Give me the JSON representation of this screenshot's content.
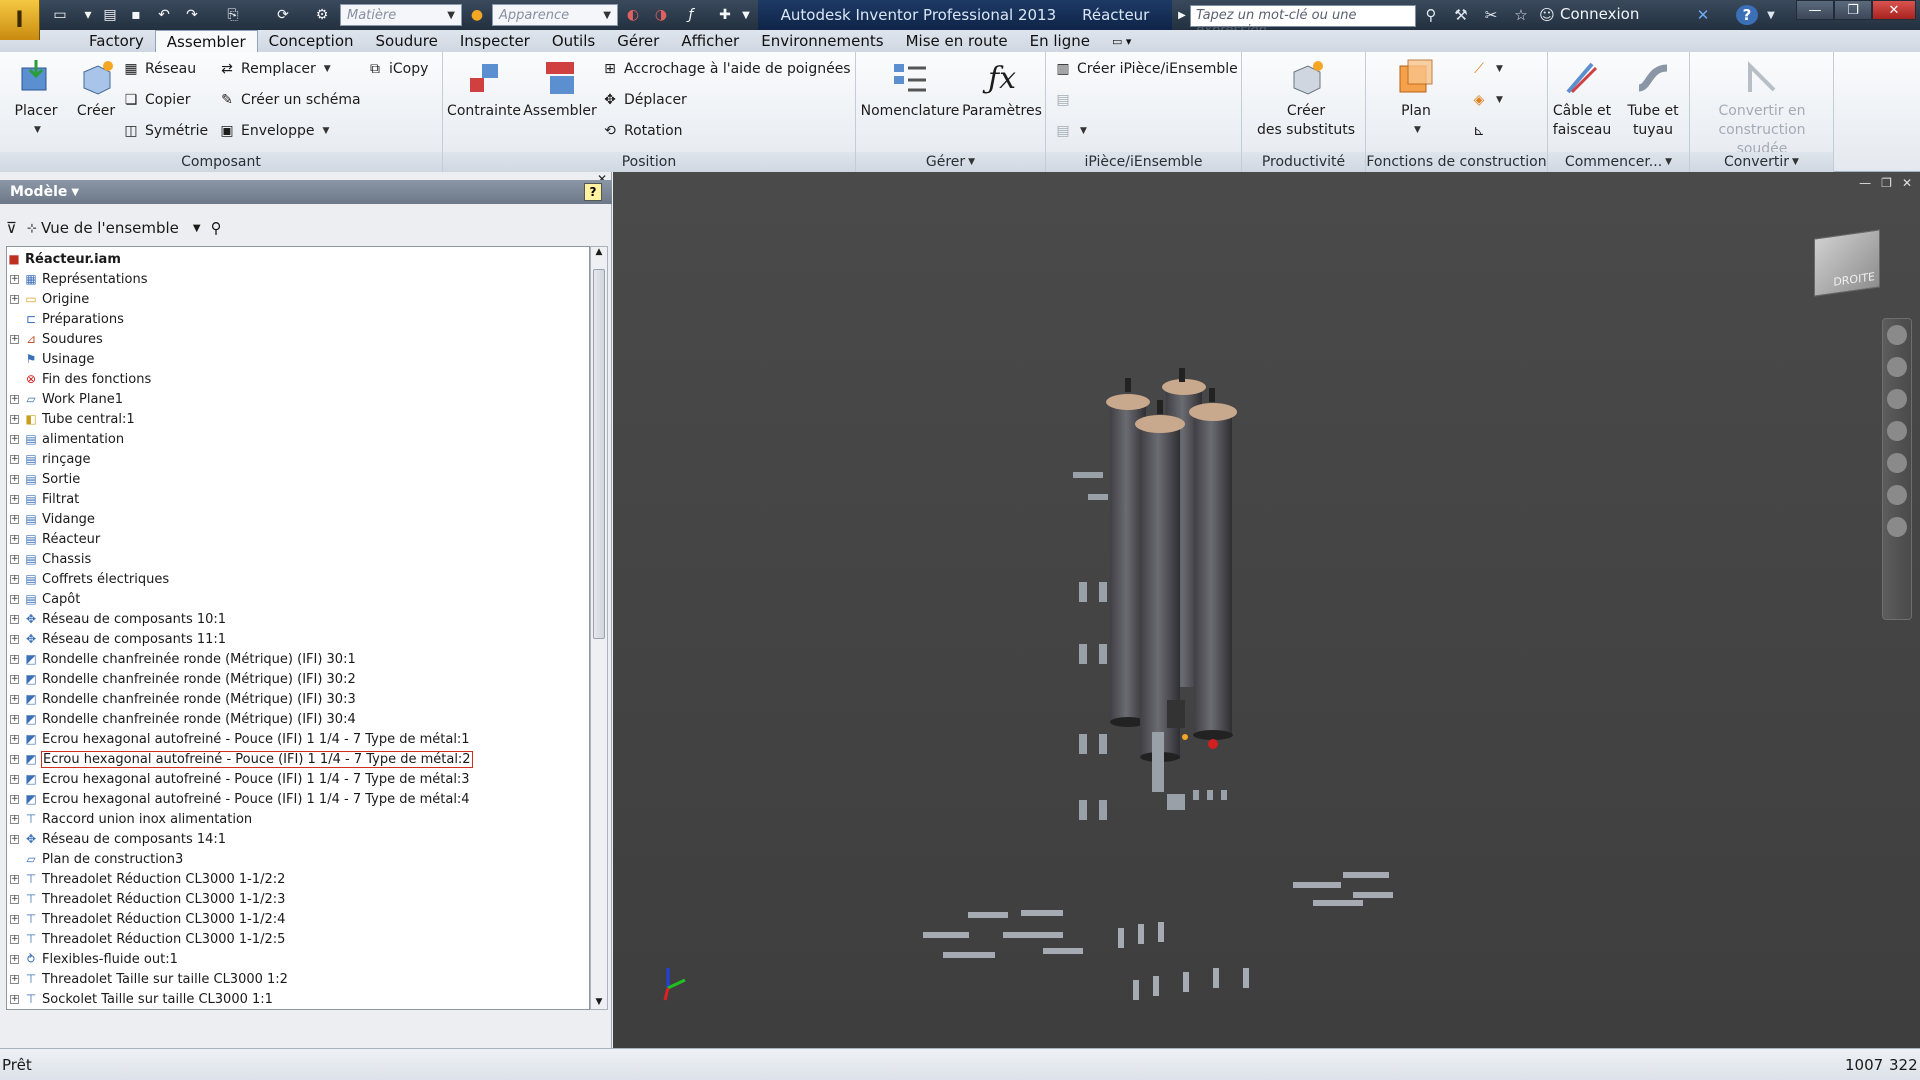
{
  "titlebar": {
    "app_title": "Autodesk Inventor Professional 2013",
    "doc_title": "Réacteur",
    "material_placeholder": "Matière",
    "appearance_placeholder": "Apparence",
    "search_placeholder": "Tapez un mot-clé ou une expression",
    "connexion": "Connexion",
    "help": "?"
  },
  "menu": {
    "tabs": [
      "Factory",
      "Assembler",
      "Conception",
      "Soudure",
      "Inspecter",
      "Outils",
      "Gérer",
      "Afficher",
      "Environnements",
      "Mise en route",
      "En ligne"
    ],
    "active": 1
  },
  "ribbon": {
    "composant": {
      "label": "Composant",
      "placer": "Placer",
      "creer": "Créer",
      "reseau": "Réseau",
      "copier": "Copier",
      "symetrie": "Symétrie",
      "remplacer": "Remplacer",
      "creer_schema": "Créer un schéma",
      "enveloppe": "Enveloppe",
      "icopy": "iCopy"
    },
    "position": {
      "label": "Position",
      "contrainte": "Contrainte",
      "assembler": "Assembler",
      "accrochage": "Accrochage à l'aide de poignées",
      "deplacer": "Déplacer",
      "rotation": "Rotation"
    },
    "gerer": {
      "label": "Gérer",
      "nomenclature": "Nomenclature",
      "parametres": "Paramètres"
    },
    "ipiece": {
      "label": "iPièce/iEnsemble",
      "creer": "Créer iPièce/iEnsemble"
    },
    "productivite": {
      "label": "Productivité",
      "creer_line1": "Créer",
      "creer_line2": "des substituts"
    },
    "fonctions": {
      "label": "Fonctions de construction",
      "plan": "Plan"
    },
    "commencer": {
      "label": "Commencer...",
      "cable_line1": "Câble et",
      "cable_line2": "faisceau",
      "tube_line1": "Tube et",
      "tube_line2": "tuyau"
    },
    "convertir": {
      "label": "Convertir",
      "conv_line1": "Convertir en",
      "conv_line2": "construction soudée"
    }
  },
  "browser": {
    "header": "Modèle",
    "view_label": "Vue de l'ensemble",
    "root": "Réacteur.iam",
    "nodes": [
      {
        "label": "Représentations",
        "exp": true,
        "icon": "representations-icon"
      },
      {
        "label": "Origine",
        "exp": true,
        "icon": "folder-icon"
      },
      {
        "label": "Préparations",
        "exp": false,
        "icon": "preparations-icon"
      },
      {
        "label": "Soudures",
        "exp": true,
        "icon": "welds-icon"
      },
      {
        "label": "Usinage",
        "exp": false,
        "icon": "machining-icon"
      },
      {
        "label": "Fin des fonctions",
        "exp": false,
        "icon": "end-of-features-icon"
      },
      {
        "label": "Work Plane1",
        "exp": true,
        "icon": "work-plane-icon"
      },
      {
        "label": "Tube central:1",
        "exp": true,
        "icon": "part-adaptive-icon"
      },
      {
        "label": "alimentation",
        "exp": true,
        "icon": "sub-assembly-icon"
      },
      {
        "label": "rinçage",
        "exp": true,
        "icon": "sub-assembly-icon"
      },
      {
        "label": "Sortie",
        "exp": true,
        "icon": "sub-assembly-icon"
      },
      {
        "label": "Filtrat",
        "exp": true,
        "icon": "sub-assembly-icon"
      },
      {
        "label": "Vidange",
        "exp": true,
        "icon": "sub-assembly-icon"
      },
      {
        "label": "Réacteur",
        "exp": true,
        "icon": "sub-assembly-icon"
      },
      {
        "label": "Chassis",
        "exp": true,
        "icon": "sub-assembly-icon"
      },
      {
        "label": "Coffrets électriques",
        "exp": true,
        "icon": "sub-assembly-icon"
      },
      {
        "label": "Capôt",
        "exp": true,
        "icon": "sub-assembly-icon"
      },
      {
        "label": "Réseau de composants 10:1",
        "exp": true,
        "icon": "pattern-icon"
      },
      {
        "label": "Réseau de composants 11:1",
        "exp": true,
        "icon": "pattern-icon"
      },
      {
        "label": "Rondelle chanfreinée ronde (Métrique) (IFI) 30:1",
        "exp": true,
        "icon": "part-icon"
      },
      {
        "label": "Rondelle chanfreinée ronde (Métrique) (IFI) 30:2",
        "exp": true,
        "icon": "part-icon"
      },
      {
        "label": "Rondelle chanfreinée ronde (Métrique) (IFI) 30:3",
        "exp": true,
        "icon": "part-icon"
      },
      {
        "label": "Rondelle chanfreinée ronde (Métrique) (IFI) 30:4",
        "exp": true,
        "icon": "part-icon"
      },
      {
        "label": "Ecrou hexagonal autofreiné - Pouce (IFI) 1 1/4 - 7 Type de métal:1",
        "exp": true,
        "icon": "part-icon"
      },
      {
        "label": "Ecrou hexagonal autofreiné - Pouce (IFI) 1 1/4 - 7 Type de métal:2",
        "exp": true,
        "icon": "part-icon",
        "selected": true
      },
      {
        "label": "Ecrou hexagonal autofreiné - Pouce (IFI) 1 1/4 - 7 Type de métal:3",
        "exp": true,
        "icon": "part-icon"
      },
      {
        "label": "Ecrou hexagonal autofreiné - Pouce (IFI) 1 1/4 - 7 Type de métal:4",
        "exp": true,
        "icon": "part-icon"
      },
      {
        "label": "Raccord union inox alimentation",
        "exp": true,
        "icon": "fitting-icon"
      },
      {
        "label": "Réseau de composants 14:1",
        "exp": true,
        "icon": "pattern-icon"
      },
      {
        "label": "Plan de construction3",
        "exp": false,
        "icon": "work-plane-icon"
      },
      {
        "label": "Threadolet Réduction CL3000 1-1/2:2",
        "exp": true,
        "icon": "fitting-icon"
      },
      {
        "label": "Threadolet Réduction CL3000 1-1/2:3",
        "exp": true,
        "icon": "fitting-icon"
      },
      {
        "label": "Threadolet Réduction CL3000 1-1/2:4",
        "exp": true,
        "icon": "fitting-icon"
      },
      {
        "label": "Threadolet Réduction CL3000 1-1/2:5",
        "exp": true,
        "icon": "fitting-icon"
      },
      {
        "label": "Flexibles-fluide out:1",
        "exp": true,
        "icon": "flexible-icon"
      },
      {
        "label": "Threadolet Taille sur taille CL3000 1:2",
        "exp": true,
        "icon": "fitting-icon"
      },
      {
        "label": "Sockolet Taille sur taille CL3000 1:1",
        "exp": true,
        "icon": "fitting-icon"
      }
    ]
  },
  "viewport": {
    "viewcube_label": "DROITE"
  },
  "status": {
    "text": "Prêt",
    "num1": "1007",
    "num2": "322"
  },
  "colors": {
    "title_bg": "#22303f",
    "viewport_bg": "#444444",
    "selection": "#d03020"
  }
}
